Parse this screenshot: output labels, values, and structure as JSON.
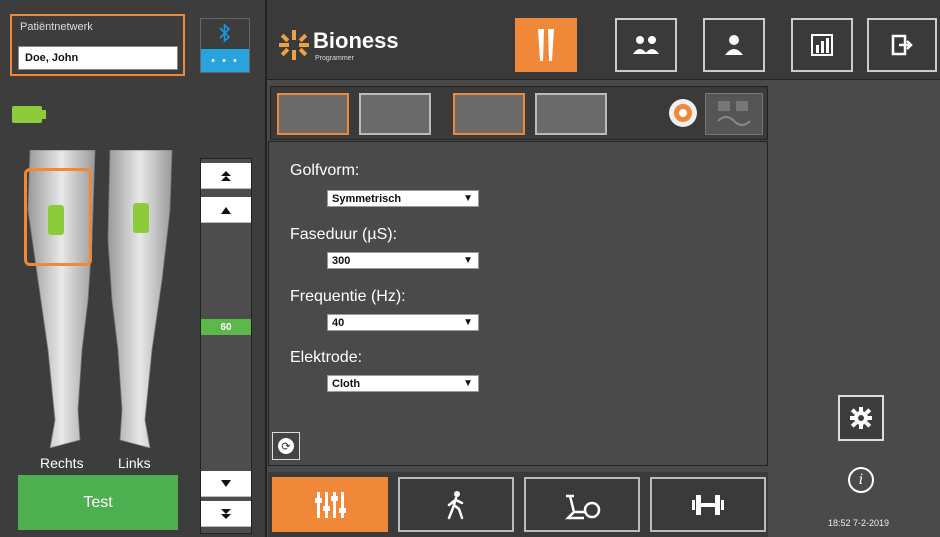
{
  "patient": {
    "label": "Patiëntnetwerk",
    "name": "Doe, John"
  },
  "bluetooth": {
    "status_dots": "• • •"
  },
  "brand": {
    "name": "Bioness",
    "sub": "Programmer"
  },
  "nav": {
    "legs": "▐▌",
    "group": "👥",
    "user": "👤",
    "report": "📊",
    "exit": "⏏"
  },
  "legs": {
    "right_label": "Rechts",
    "left_label": "Links"
  },
  "intensity": {
    "value": "60",
    "up_fast": "⯭",
    "up": "▲",
    "down": "▼",
    "down_fast": "⯯"
  },
  "test_button": "Test",
  "modes": {
    "thumb1": "",
    "thumb2": "",
    "thumb3": "",
    "thumb4": ""
  },
  "settings": {
    "golfvorm_label": "Golfvorm:",
    "golfvorm_value": "Symmetrisch",
    "faseduur_label": "Faseduur (µS):",
    "faseduur_value": "300",
    "frequentie_label": "Frequentie (Hz):",
    "frequentie_value": "40",
    "elektrode_label": "Elektrode:",
    "elektrode_value": "Cloth"
  },
  "program_buttons": {
    "mixer": "⫼",
    "walk": "🚶",
    "bike": "🚲",
    "weights": "⟛"
  },
  "clock": "18:52 7-2-2019",
  "colors": {
    "accent": "#f0883a",
    "bluetooth": "#29a3dd",
    "battery": "#8ccc3a",
    "test": "#4caf50",
    "slider_value": "#5cb84a"
  }
}
